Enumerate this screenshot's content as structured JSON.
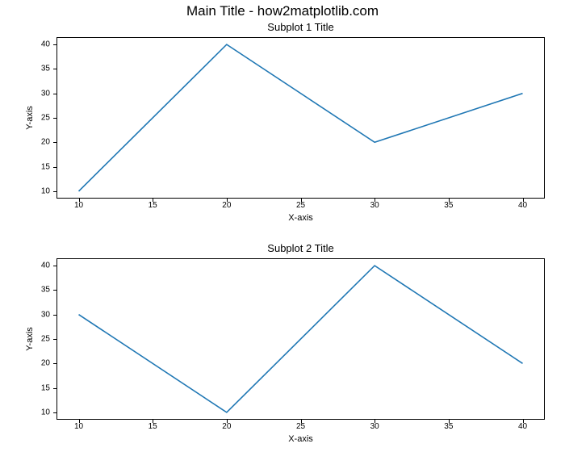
{
  "main_title": "Main Title - how2matplotlib.com",
  "chart_data": [
    {
      "type": "line",
      "title": "Subplot 1 Title",
      "xlabel": "X-axis",
      "ylabel": "Y-axis",
      "x": [
        10,
        20,
        30,
        40
      ],
      "values": [
        10,
        40,
        20,
        30
      ],
      "xticks": [
        10,
        15,
        20,
        25,
        30,
        35,
        40
      ],
      "yticks": [
        10,
        15,
        20,
        25,
        30,
        35,
        40
      ],
      "xlim": [
        8.5,
        41.5
      ],
      "ylim": [
        8.5,
        41.5
      ]
    },
    {
      "type": "line",
      "title": "Subplot 2 Title",
      "xlabel": "X-axis",
      "ylabel": "Y-axis",
      "x": [
        10,
        20,
        30,
        40
      ],
      "values": [
        30,
        10,
        40,
        20
      ],
      "xticks": [
        10,
        15,
        20,
        25,
        30,
        35,
        40
      ],
      "yticks": [
        10,
        15,
        20,
        25,
        30,
        35,
        40
      ],
      "xlim": [
        8.5,
        41.5
      ],
      "ylim": [
        8.5,
        41.5
      ]
    }
  ]
}
